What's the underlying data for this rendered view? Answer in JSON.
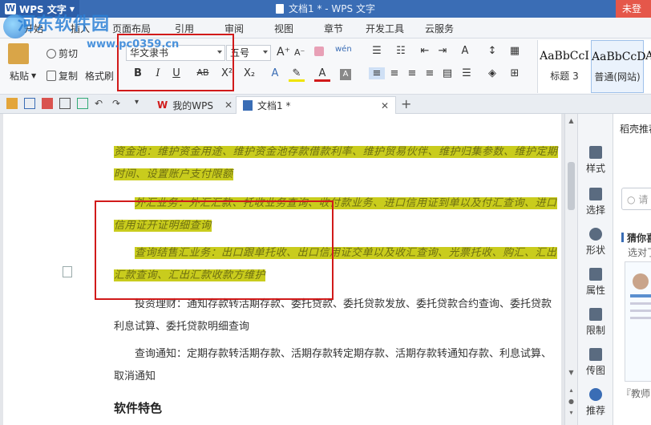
{
  "titlebar": {
    "app_name": "WPS 文字",
    "doc_title": "文档1 * - WPS 文字",
    "signin": "未登"
  },
  "watermark": {
    "text": "河东软件园",
    "url": "www.pc0359.cn"
  },
  "menu_tabs": [
    "开始",
    "插入",
    "页面布局",
    "引用",
    "审阅",
    "视图",
    "章节",
    "开发工具",
    "云服务"
  ],
  "ribbon": {
    "paste": "粘贴",
    "cut": "剪切",
    "copy": "复制",
    "format_painter": "格式刷",
    "font_name": "华文隶书",
    "font_size": "五号",
    "bold": "B",
    "italic": "I",
    "underline": "U",
    "strike": "AB",
    "superscript": "X²",
    "subscript": "X₂",
    "grow_font": "A⁺",
    "shrink_font": "A⁻",
    "phonetic": "wén",
    "styles": [
      {
        "sample": "AaBbCcI",
        "name": "标题 3"
      },
      {
        "sample": "AaBbCcD",
        "name": "普通(网站)"
      }
    ],
    "style_overflow": "A"
  },
  "tabs": [
    {
      "label": "我的WPS"
    },
    {
      "label": "文档1 *"
    }
  ],
  "document": {
    "paragraphs_highlighted": [
      "资金池：维护资金用途、维护资金池存款借款利率、维护贸易伙伴、维护归集参数、维护定期时间、设置账户支付限额",
      "外汇业务：外汇汇款、托收业务查询、收付款业务、进口信用证到单以及付汇查询、进口信用证开证明细查询",
      "查询结售汇业务：出口跟单托收、出口信用证交单以及收汇查询、光票托收、购汇、汇出汇款查询、汇出汇款收款方维护"
    ],
    "paragraphs": [
      "投资理财：通知存款转活期存款、委托贷款、委托贷款发放、委托贷款合约查询、委托贷款利息试算、委托贷款明细查询",
      "查询通知：定期存款转活期存款、活期存款转定期存款、活期存款转通知存款、利息试算、取消通知"
    ],
    "heading": "软件特色"
  },
  "right_toolbar": [
    "样式",
    "选择",
    "形状",
    "属性",
    "限制",
    "传图",
    "推荐"
  ],
  "right_panel": {
    "title": "稻壳推荐",
    "search_placeholder": "请",
    "section": "猜你喜",
    "section_sub": "选对了",
    "bottom": "『教师"
  }
}
